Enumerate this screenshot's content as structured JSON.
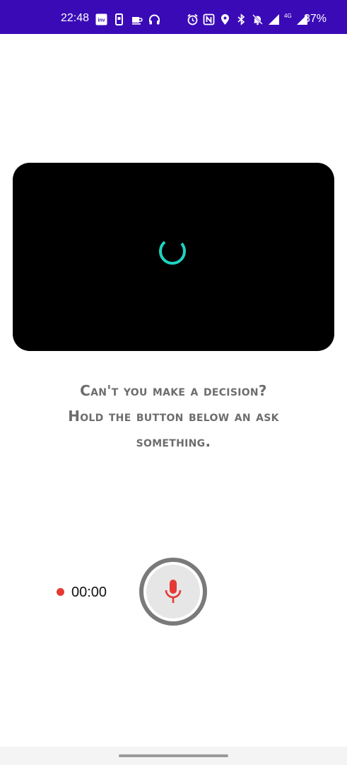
{
  "status_bar": {
    "time": "22:48",
    "battery": "87%",
    "network_label": "4G",
    "bg_color": "#3a0ab7",
    "left_icons": [
      "inv-app-icon",
      "phone-notification-icon",
      "coffee-icon",
      "headphones-icon"
    ],
    "right_icons": [
      "alarm-icon",
      "nfc-icon",
      "location-icon",
      "bluetooth-icon",
      "mute-bell-icon",
      "wifi-signal-icon",
      "cell-signal-icon"
    ]
  },
  "video": {
    "state": "loading",
    "spinner_color": "#1fd3c0"
  },
  "prompt": {
    "line1": "Can't you make a decision?",
    "line2": "Hold the button below an ask",
    "line3": "something."
  },
  "recorder": {
    "timer": "00:00",
    "dot_color": "#e53935",
    "mic_icon": "microphone-icon",
    "mic_color": "#e53935"
  }
}
